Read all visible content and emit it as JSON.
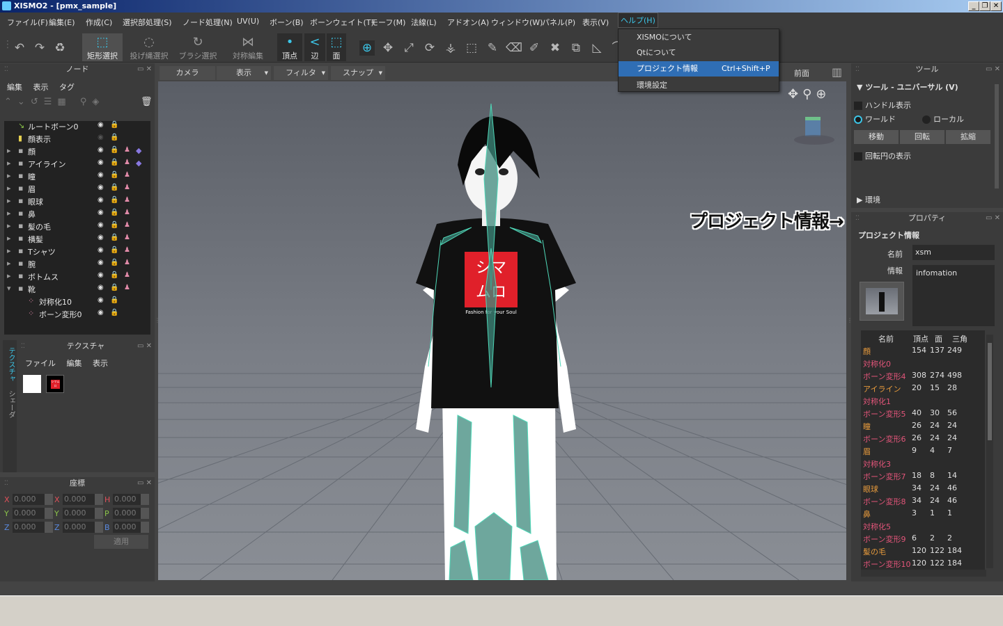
{
  "window": {
    "title": "XISMO2 - [pmx_sample]"
  },
  "menubar": [
    "ファイル(F)",
    "編集(E)",
    "作成(C)",
    "選択部処理(S)",
    "ノード処理(N)",
    "UV(U)",
    "ボーン(B)",
    "ボーンウェイト(T)",
    "モーフ(M)",
    "法線(L)",
    "アドオン(A)",
    "ウィンドウ(W)",
    "パネル(P)",
    "表示(V)",
    "ヘルプ(H)"
  ],
  "toolbar": {
    "rect_select": "矩形選択",
    "lasso_select": "投げ縄選択",
    "brush_select": "ブラシ選択",
    "symmetry_edit": "対称編集",
    "vertex": "頂点",
    "edge": "辺",
    "face": "面"
  },
  "help_menu": {
    "items": [
      {
        "label": "XISMOについて",
        "shortcut": ""
      },
      {
        "label": "Qtについて",
        "shortcut": ""
      },
      {
        "label": "プロジェクト情報",
        "shortcut": "Ctrl+Shift+P"
      },
      {
        "label": "環境設定",
        "shortcut": ""
      }
    ]
  },
  "node_panel": {
    "title": "ノード",
    "submenu": [
      "編集",
      "表示",
      "タグ"
    ],
    "nodes": [
      {
        "label": "ルートボーン0"
      },
      {
        "label": "顔表示"
      },
      {
        "label": "顔"
      },
      {
        "label": "アイライン"
      },
      {
        "label": "瞳"
      },
      {
        "label": "眉"
      },
      {
        "label": "眼球"
      },
      {
        "label": "鼻"
      },
      {
        "label": "髪の毛"
      },
      {
        "label": "横髪"
      },
      {
        "label": "Tシャツ"
      },
      {
        "label": "腕"
      },
      {
        "label": "ボトムス"
      },
      {
        "label": "靴"
      },
      {
        "label": "対称化10"
      },
      {
        "label": "ボーン変形0"
      }
    ]
  },
  "texture_panel": {
    "title": "テクスチャ",
    "submenu": [
      "ファイル",
      "編集",
      "表示"
    ],
    "side_tabs": [
      "テクスチャ",
      "シェーダ"
    ],
    "thumb_text": "シマムロ"
  },
  "coord_panel": {
    "title": "座標",
    "labels": [
      "X",
      "Y",
      "Z",
      "X",
      "Y",
      "Z",
      "H",
      "P",
      "B"
    ],
    "value": "0.000",
    "apply": "適用"
  },
  "viewport": {
    "camera": "カメラ",
    "display": "表示",
    "filter": "フィルタ",
    "snap": "スナップ",
    "view": "前面",
    "shirt_logo": "シマムロ",
    "shirt_tagline": "Fashion for your Soul"
  },
  "tool_panel": {
    "title": "ツール",
    "heading": "ツール - ユニバーサル (V)",
    "handle_display": "ハンドル表示",
    "world": "ワールド",
    "local": "ローカル",
    "move": "移動",
    "rotate": "回転",
    "scale": "拡縮",
    "rotation_circle": "回転円の表示",
    "environment": "環境"
  },
  "annotation": "プロジェクト情報→",
  "property_panel": {
    "title": "プロパティ",
    "heading": "プロジェクト情報",
    "name_label": "名前",
    "name_value": "xsm",
    "info_label": "情報",
    "info_value": "infomation",
    "table_headers": [
      "名前",
      "頂点",
      "面",
      "三角"
    ],
    "rows": [
      {
        "name": "顔",
        "v": "154",
        "f": "137",
        "t": "249",
        "orange": true
      },
      {
        "name": "対称化0",
        "v": "",
        "f": "",
        "t": "",
        "orange": false
      },
      {
        "name": "ボーン変形4",
        "v": "308",
        "f": "274",
        "t": "498",
        "orange": false
      },
      {
        "name": "アイライン",
        "v": "20",
        "f": "15",
        "t": "28",
        "orange": true
      },
      {
        "name": "対称化1",
        "v": "",
        "f": "",
        "t": "",
        "orange": false
      },
      {
        "name": "ボーン変形5",
        "v": "40",
        "f": "30",
        "t": "56",
        "orange": false
      },
      {
        "name": "瞳",
        "v": "26",
        "f": "24",
        "t": "24",
        "orange": true
      },
      {
        "name": "ボーン変形6",
        "v": "26",
        "f": "24",
        "t": "24",
        "orange": false
      },
      {
        "name": "眉",
        "v": "9",
        "f": "4",
        "t": "7",
        "orange": true
      },
      {
        "name": "対称化3",
        "v": "",
        "f": "",
        "t": "",
        "orange": false
      },
      {
        "name": "ボーン変形7",
        "v": "18",
        "f": "8",
        "t": "14",
        "orange": false
      },
      {
        "name": "眼球",
        "v": "34",
        "f": "24",
        "t": "46",
        "orange": true
      },
      {
        "name": "ボーン変形8",
        "v": "34",
        "f": "24",
        "t": "46",
        "orange": false
      },
      {
        "name": "鼻",
        "v": "3",
        "f": "1",
        "t": "1",
        "orange": true
      },
      {
        "name": "対称化5",
        "v": "",
        "f": "",
        "t": "",
        "orange": false
      },
      {
        "name": "ボーン変形9",
        "v": "6",
        "f": "2",
        "t": "2",
        "orange": false
      },
      {
        "name": "髪の毛",
        "v": "120",
        "f": "122",
        "t": "184",
        "orange": true
      },
      {
        "name": "ボーン変形10",
        "v": "120",
        "f": "122",
        "t": "184",
        "orange": false
      }
    ]
  }
}
